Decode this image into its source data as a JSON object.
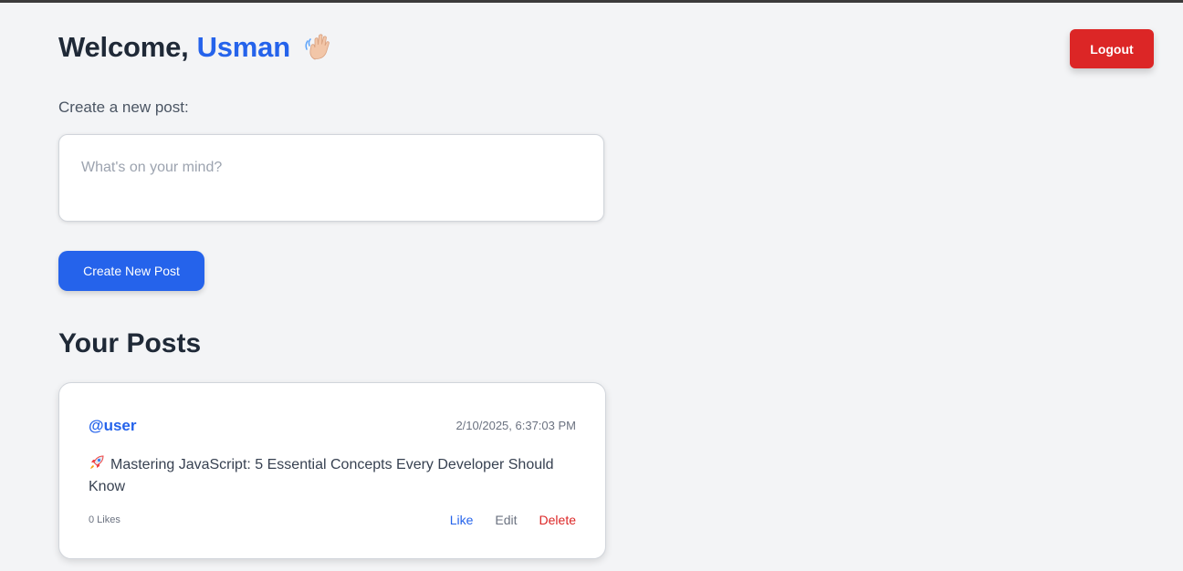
{
  "header": {
    "welcome_prefix": "Welcome,",
    "username": "Usman",
    "wave_icon": "waving-hand-icon",
    "logout_label": "Logout"
  },
  "composer": {
    "label": "Create a new post:",
    "placeholder": "What's on your mind?",
    "value": "",
    "submit_label": "Create New Post"
  },
  "posts_section": {
    "title": "Your Posts",
    "posts": [
      {
        "user": "@user",
        "timestamp": "2/10/2025, 6:37:03 PM",
        "icon": "rocket-icon",
        "content": "Mastering JavaScript: 5 Essential Concepts Every Developer Should Know",
        "likes": "0 Likes",
        "actions": {
          "like": "Like",
          "edit": "Edit",
          "delete": "Delete"
        }
      }
    ]
  },
  "colors": {
    "accent": "#2563eb",
    "danger": "#dc2626",
    "background": "#f3f4f6",
    "text": "#1f2937"
  }
}
